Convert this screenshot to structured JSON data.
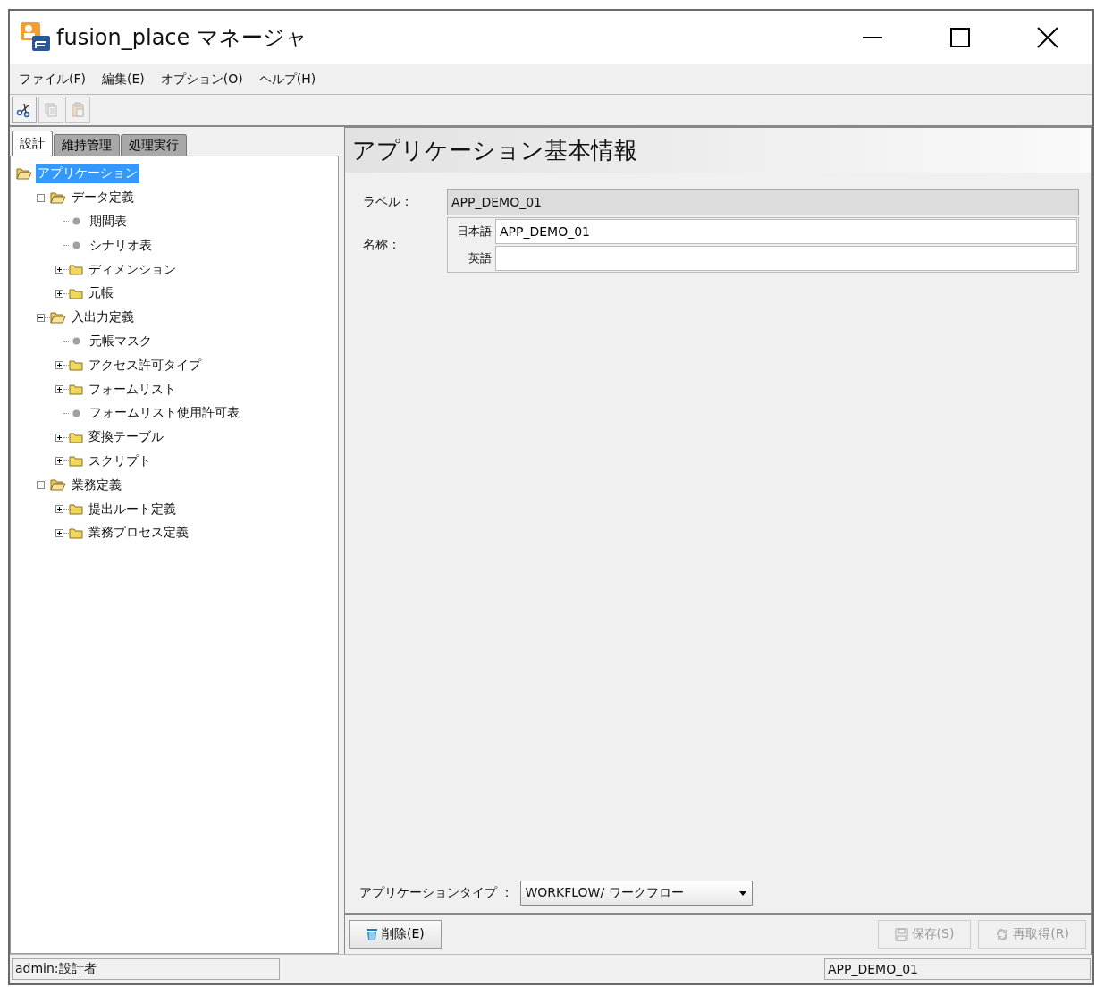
{
  "window": {
    "title": "fusion_place マネージャ"
  },
  "menu": [
    "ファイル(F)",
    "編集(E)",
    "オプション(O)",
    "ヘルプ(H)"
  ],
  "toolbar": [
    {
      "kind": "cut",
      "disabled": false
    },
    {
      "kind": "copy",
      "disabled": true
    },
    {
      "kind": "paste",
      "disabled": true
    }
  ],
  "tabs": [
    {
      "label": "設計",
      "selected": true
    },
    {
      "label": "維持管理",
      "selected": false
    },
    {
      "label": "処理実行",
      "selected": false
    }
  ],
  "tree": [
    {
      "label": "アプリケーション",
      "kind": "folder",
      "expanded": true,
      "selected": true,
      "children": [
        {
          "label": "データ定義",
          "kind": "folder",
          "expanded": true,
          "selected": false,
          "children": [
            {
              "label": "期間表",
              "kind": "leaf",
              "selected": false
            },
            {
              "label": "シナリオ表",
              "kind": "leaf",
              "selected": false
            },
            {
              "label": "ディメンション",
              "kind": "folder",
              "expanded": false,
              "selected": false
            },
            {
              "label": "元帳",
              "kind": "folder",
              "expanded": false,
              "selected": false
            }
          ]
        },
        {
          "label": "入出力定義",
          "kind": "folder",
          "expanded": true,
          "selected": false,
          "children": [
            {
              "label": "元帳マスク",
              "kind": "leaf",
              "selected": false
            },
            {
              "label": "アクセス許可タイプ",
              "kind": "folder",
              "expanded": false,
              "selected": false
            },
            {
              "label": "フォームリスト",
              "kind": "folder",
              "expanded": false,
              "selected": false
            },
            {
              "label": "フォームリスト使用許可表",
              "kind": "leaf",
              "selected": false
            },
            {
              "label": "変換テーブル",
              "kind": "folder",
              "expanded": false,
              "selected": false
            },
            {
              "label": "スクリプト",
              "kind": "folder",
              "expanded": false,
              "selected": false
            }
          ]
        },
        {
          "label": "業務定義",
          "kind": "folder",
          "expanded": true,
          "selected": false,
          "children": [
            {
              "label": "提出ルート定義",
              "kind": "folder",
              "expanded": false,
              "selected": false
            },
            {
              "label": "業務プロセス定義",
              "kind": "folder",
              "expanded": false,
              "selected": false
            }
          ]
        }
      ]
    }
  ],
  "panel": {
    "title": "アプリケーション基本情報",
    "label_field": {
      "label": "ラベル：",
      "value": "APP_DEMO_01"
    },
    "name_field": {
      "label": "名称：",
      "rows": [
        {
          "lang": "日本語",
          "value": "APP_DEMO_01"
        },
        {
          "lang": "英語",
          "value": ""
        }
      ]
    },
    "type_field": {
      "label": "アプリケーションタイプ ：",
      "value": "WORKFLOW/ ワークフロー"
    }
  },
  "buttons": [
    {
      "kind": "delete",
      "label": "削除(E)",
      "disabled": false
    },
    {
      "kind": "save",
      "label": "保存(S)",
      "disabled": true
    },
    {
      "kind": "reload",
      "label": "再取得(R)",
      "disabled": true
    }
  ],
  "status_bar": {
    "user": "admin:設計者",
    "application": "APP_DEMO_01"
  }
}
